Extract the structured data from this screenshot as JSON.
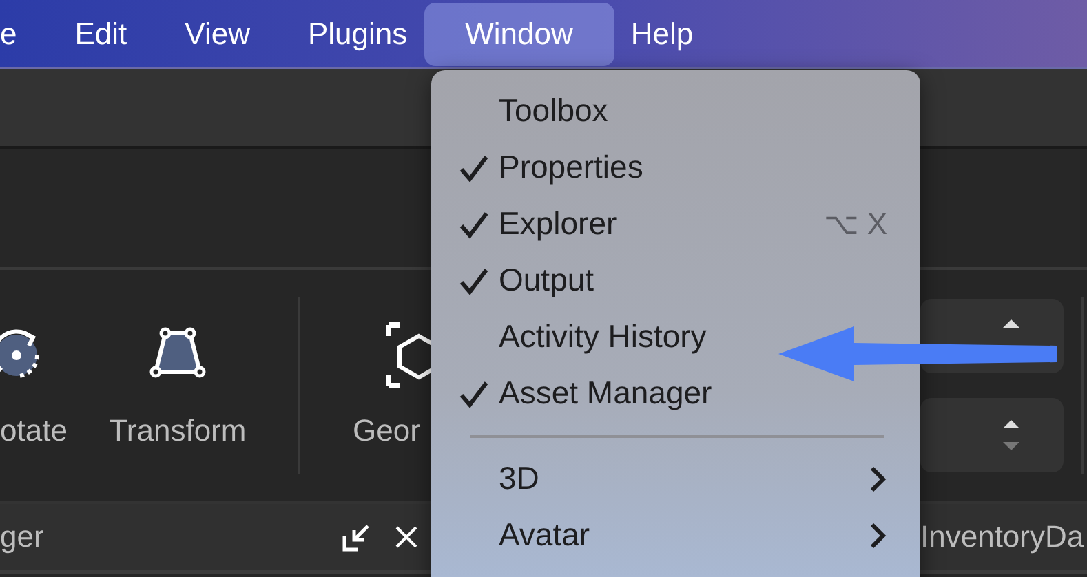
{
  "menubar": {
    "items": [
      {
        "label": "e",
        "selected": false
      },
      {
        "label": "Edit",
        "selected": false
      },
      {
        "label": "View",
        "selected": false
      },
      {
        "label": "Plugins",
        "selected": false
      },
      {
        "label": "Window",
        "selected": true
      },
      {
        "label": "Help",
        "selected": false
      }
    ]
  },
  "toolbar": {
    "tools": [
      {
        "label": "otate",
        "kind": "rotate"
      },
      {
        "label": "Transform",
        "kind": "transform"
      },
      {
        "label": "Geor",
        "kind": "geometry"
      }
    ]
  },
  "panel": {
    "title": "ger",
    "tab_title": "InventoryDa"
  },
  "window_menu": {
    "items": [
      {
        "kind": "item",
        "label": "Toolbox",
        "checked": false
      },
      {
        "kind": "item",
        "label": "Properties",
        "checked": true
      },
      {
        "kind": "item",
        "label": "Explorer",
        "checked": true,
        "shortcut": "⌥ X"
      },
      {
        "kind": "item",
        "label": "Output",
        "checked": true
      },
      {
        "kind": "item",
        "label": "Activity History",
        "checked": false
      },
      {
        "kind": "item",
        "label": "Asset Manager",
        "checked": true
      },
      {
        "kind": "separator"
      },
      {
        "kind": "submenu",
        "label": "3D"
      },
      {
        "kind": "submenu",
        "label": "Avatar"
      }
    ]
  }
}
